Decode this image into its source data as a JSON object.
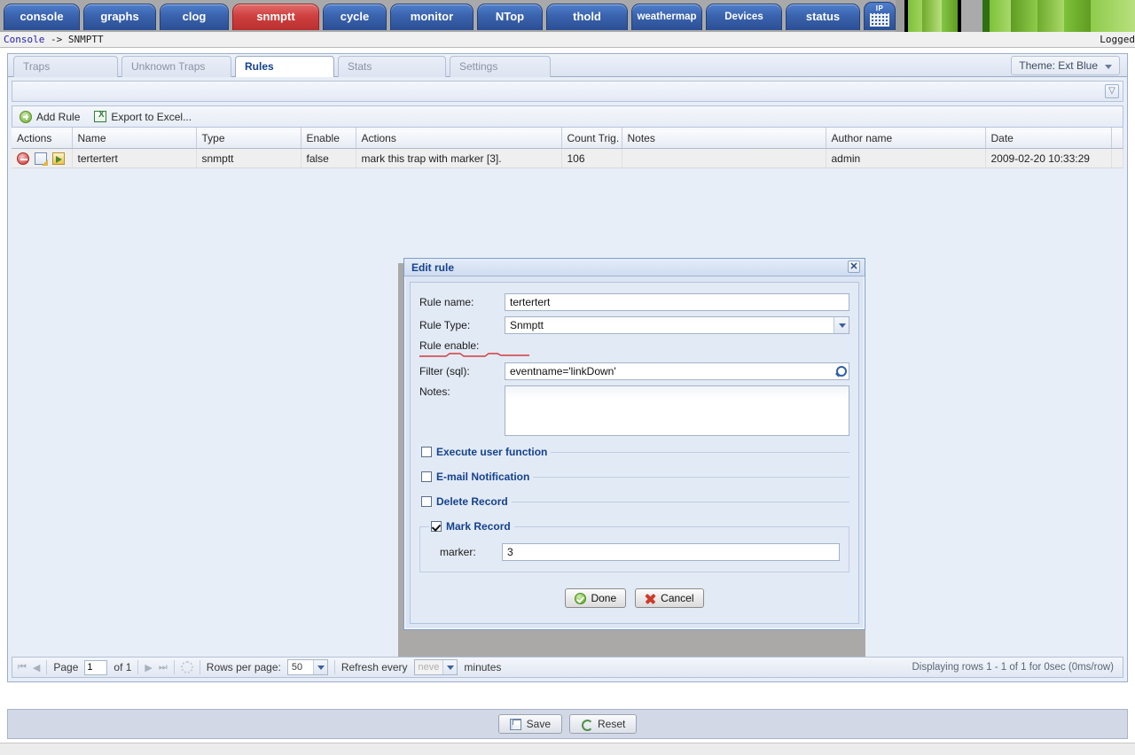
{
  "topnav": {
    "tabs": [
      {
        "label": "console",
        "active": false
      },
      {
        "label": "graphs",
        "active": false
      },
      {
        "label": "clog",
        "active": false
      },
      {
        "label": "snmptt",
        "active": true
      },
      {
        "label": "cycle",
        "active": false
      },
      {
        "label": "monitor",
        "active": false
      },
      {
        "label": "NTop",
        "active": false
      },
      {
        "label": "thold",
        "active": false
      },
      {
        "label": "weathermap",
        "active": false
      },
      {
        "label": "Devices",
        "active": false
      },
      {
        "label": "status",
        "active": false
      }
    ],
    "ip_tab_label": "IP",
    "accent_active": "#cf4040",
    "accent_normal": "#3a63ad"
  },
  "breadcrumb": {
    "root": "Console",
    "separator": " -> ",
    "current": "SNMPTT",
    "logged_text": "Logged"
  },
  "panel_tabs": [
    {
      "label": "Traps",
      "active": false
    },
    {
      "label": "Unknown Traps",
      "active": false
    },
    {
      "label": "Rules",
      "active": true
    },
    {
      "label": "Stats",
      "active": false
    },
    {
      "label": "Settings",
      "active": false
    }
  ],
  "theme": {
    "label": "Theme: Ext Blue"
  },
  "toolbar": {
    "add_rule_label": "Add Rule",
    "export_label": "Export to Excel...",
    "add_icon": "plus-circle-icon",
    "export_icon": "excel-icon"
  },
  "grid": {
    "columns": [
      "Actions",
      "Name",
      "Type",
      "Enable",
      "Actions",
      "Count Trig.",
      "Notes",
      "Author name",
      "Date"
    ],
    "rows": [
      {
        "name": "tertertert",
        "type": "snmptt",
        "enable": "false",
        "action_text": "mark this trap with marker [3].",
        "count_trig": "106",
        "notes": "",
        "author": "admin",
        "date": "2009-02-20 10:33:29"
      }
    ]
  },
  "modal": {
    "title": "Edit rule",
    "close_icon": "close-icon",
    "fields": {
      "rule_name_label": "Rule name:",
      "rule_name_value": "tertertert",
      "rule_type_label": "Rule Type:",
      "rule_type_value": "Snmptt",
      "rule_enable_label": "Rule enable:",
      "filter_label": "Filter (sql):",
      "filter_value": "eventname='linkDown'",
      "notes_label": "Notes:",
      "notes_value": ""
    },
    "sections": [
      {
        "label": "Execute user function",
        "checked": false
      },
      {
        "label": "E-mail Notification",
        "checked": false
      },
      {
        "label": "Delete Record",
        "checked": false
      }
    ],
    "mark_record": {
      "label": "Mark Record",
      "checked": true,
      "marker_label": "marker:",
      "marker_value": "3"
    },
    "buttons": {
      "done": "Done",
      "cancel": "Cancel"
    }
  },
  "pager": {
    "page_label": "Page",
    "page_value": "1",
    "of_label": "of 1",
    "rows_per_page_label": "Rows per page:",
    "rows_per_page_value": "50",
    "refresh_label": "Refresh every",
    "refresh_value": "neve",
    "minutes_label": "minutes",
    "status": "Displaying rows 1 - 1 of 1 for 0sec (0ms/row)"
  },
  "savebar": {
    "save_label": "Save",
    "reset_label": "Reset"
  }
}
